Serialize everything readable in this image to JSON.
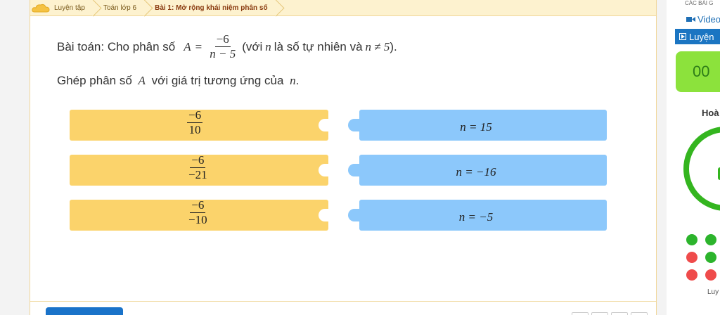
{
  "breadcrumb": {
    "items": [
      "Luyện tập",
      "Toán lớp 6",
      "Bài 1: Mở rộng khái niệm phân số"
    ]
  },
  "problem": {
    "prefix": "Bài toán: Cho phân số",
    "var_a": "A",
    "equals": "=",
    "numerator": "−6",
    "denominator": "n − 5",
    "suffix_open": "(với",
    "var_n": "n",
    "suffix_mid": "là số tự nhiên và",
    "condition": "n ≠ 5",
    "suffix_close": ")."
  },
  "instruction": {
    "prefix": "Ghép phân số",
    "var_a": "A",
    "middle": "với giá trị tương ứng của",
    "var_n": "n",
    "suffix": "."
  },
  "left_tiles": [
    {
      "numerator": "−6",
      "denominator": "10"
    },
    {
      "numerator": "−6",
      "denominator": "−21"
    },
    {
      "numerator": "−6",
      "denominator": "−10"
    }
  ],
  "right_tiles": [
    {
      "label": "n = 15"
    },
    {
      "label": "n = −16"
    },
    {
      "label": "n = −5"
    }
  ],
  "sidebar": {
    "section_title": "CÁC BÀI G",
    "video_label": "Video",
    "practice_label": "Luyện",
    "timer": "00",
    "complete_label": "Hoà",
    "progress_label": "Luy",
    "progress_dots": [
      {
        "color": "#2cb42c"
      },
      {
        "color": "#2cb42c"
      },
      {
        "color": "#ef4b4b"
      },
      {
        "color": "#2cb42c"
      },
      {
        "color": "#ef4b4b"
      },
      {
        "color": "#ef4b4b"
      }
    ]
  },
  "colors": {
    "accent_yellow": "#fbd36b",
    "accent_blue": "#8cc8fb",
    "brand_blue": "#1b75c2",
    "success_green": "#34b51f"
  }
}
